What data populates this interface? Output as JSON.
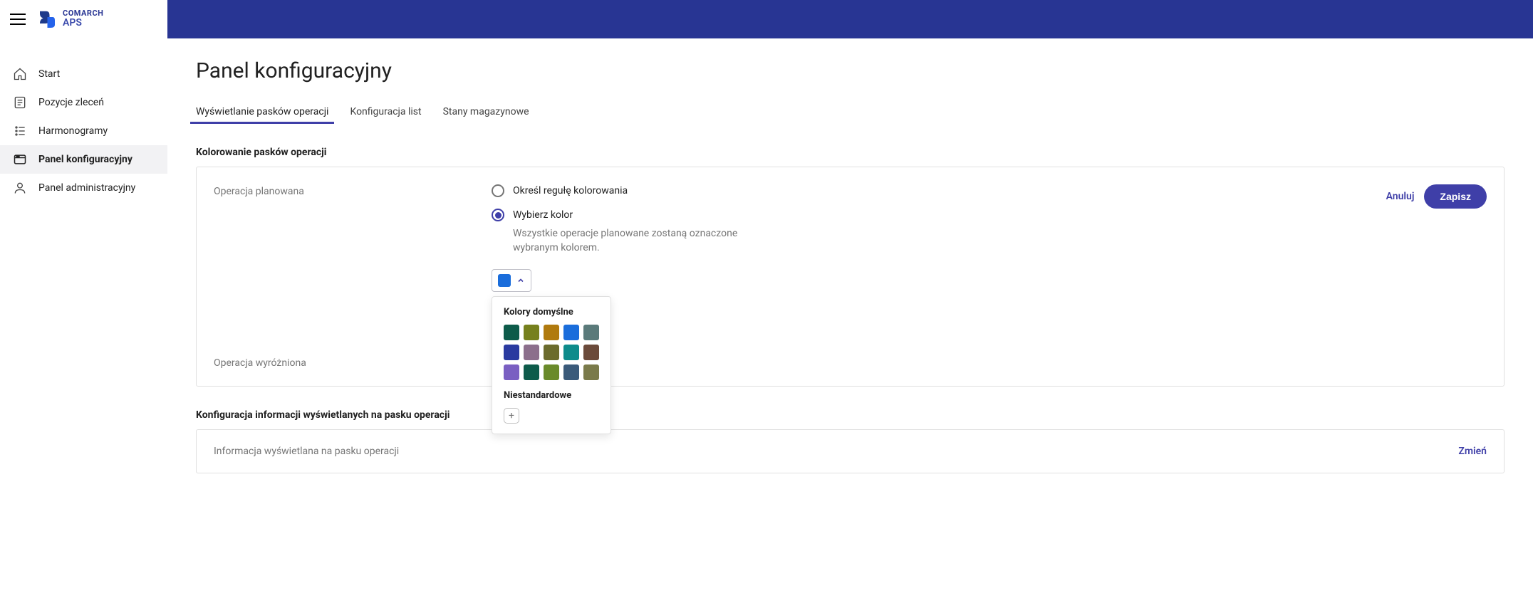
{
  "brand": {
    "company": "COMARCH",
    "product": "APS"
  },
  "nav": [
    {
      "label": "Start"
    },
    {
      "label": "Pozycje zleceń"
    },
    {
      "label": "Harmonogramy"
    },
    {
      "label": "Panel konfiguracyjny"
    },
    {
      "label": "Panel administracyjny"
    }
  ],
  "page": {
    "title": "Panel konfiguracyjny"
  },
  "tabs": [
    {
      "label": "Wyświetlanie pasków operacji"
    },
    {
      "label": "Konfiguracja list"
    },
    {
      "label": "Stany magazynowe"
    }
  ],
  "section1": {
    "title": "Kolorowanie pasków operacji",
    "row1": {
      "label": "Operacja planowana",
      "opt1": "Określ regułę kolorowania",
      "opt2": "Wybierz kolor",
      "hint": "Wszystkie operacje planowane zostaną oznaczone wybranym kolorem."
    },
    "row2": {
      "label": "Operacja wyróżniona"
    },
    "cancel": "Anuluj",
    "save": "Zapisz"
  },
  "popover": {
    "defaults_title": "Kolory domyślne",
    "custom_title": "Niestandardowe",
    "colors": [
      "#0d5b4a",
      "#76801d",
      "#b07a0e",
      "#1a6ddb",
      "#5a7a7a",
      "#2a3aa0",
      "#8c6f8c",
      "#6b6b2c",
      "#0d8b8b",
      "#6b4a3a",
      "#7a5fc2",
      "#0d5b4a",
      "#6a8a2a",
      "#3a5a7a",
      "#7a7a4a"
    ],
    "selected": "#1a6ddb"
  },
  "section2": {
    "title": "Konfiguracja informacji wyświetlanych na pasku operacji",
    "row1": {
      "label": "Informacja wyświetlana na pasku operacji"
    },
    "change": "Zmień"
  }
}
